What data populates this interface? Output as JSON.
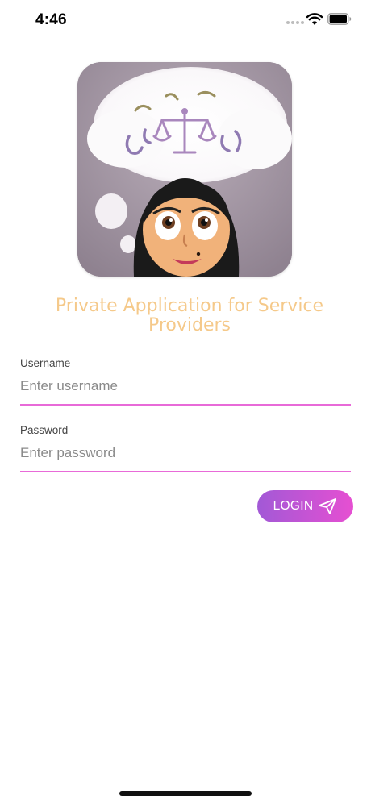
{
  "status_bar": {
    "time": "4:46",
    "icons": [
      "signal-dots-icon",
      "wifi-icon",
      "battery-icon"
    ]
  },
  "logo": {
    "icon": "app-logo-icon"
  },
  "header": {
    "subtitle": "Private Application for Service Providers"
  },
  "form": {
    "username": {
      "label": "Username",
      "placeholder": "Enter username",
      "value": ""
    },
    "password": {
      "label": "Password",
      "placeholder": "Enter password",
      "value": ""
    },
    "login": {
      "label": "LOGIN",
      "icon": "send-icon"
    }
  },
  "colors": {
    "accent": "#e86ad8",
    "button_start": "#a259d6",
    "button_end": "#e64fd2",
    "subtitle": "#f5c98a"
  }
}
